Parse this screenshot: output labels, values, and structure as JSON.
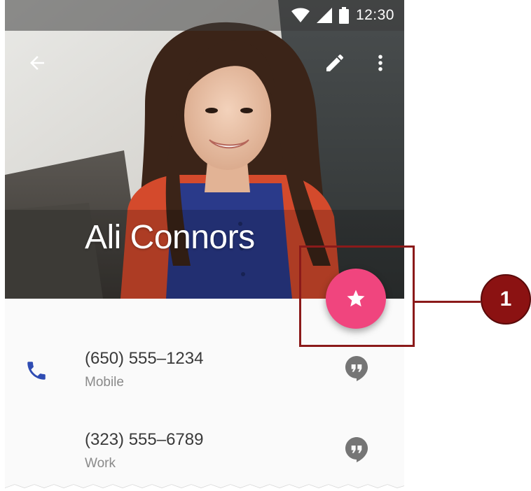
{
  "status_bar": {
    "time": "12:30",
    "icons": [
      "wifi-icon",
      "signal-icon",
      "battery-icon"
    ]
  },
  "app_bar": {
    "back_icon": "arrow-back-icon",
    "edit_icon": "pencil-icon",
    "more_icon": "more-vert-icon"
  },
  "contact": {
    "name": "Ali Connors",
    "favorite_icon": "star-icon"
  },
  "phones": [
    {
      "number": "(650) 555–1234",
      "type": "Mobile",
      "action_icon": "hangouts-icon"
    },
    {
      "number": "(323) 555–6789",
      "type": "Work",
      "action_icon": "hangouts-icon"
    }
  ],
  "annotation": {
    "label": "1"
  },
  "colors": {
    "fab": "#f0457e",
    "phone_icon": "#2f4cb3",
    "callout": "#8b1a1a",
    "secondary_text": "#8a8a8a",
    "primary_text": "#3a3a3a",
    "hangout_icon": "#757575"
  }
}
